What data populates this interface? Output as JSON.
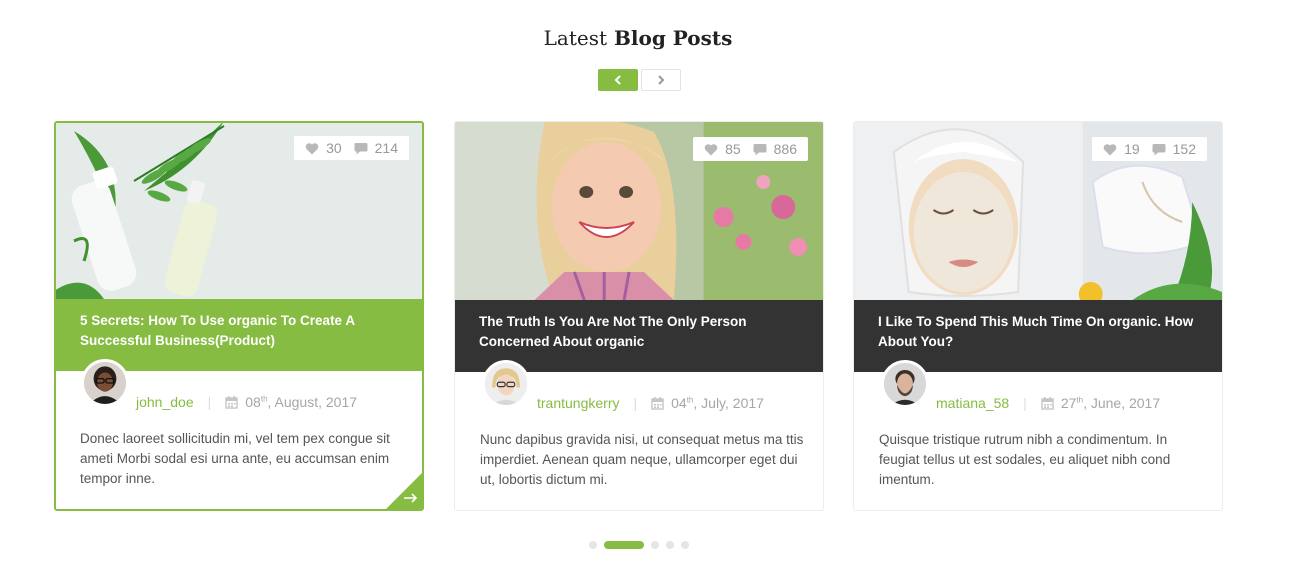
{
  "section": {
    "title_light": "Latest",
    "title_bold": "Blog Posts"
  },
  "nav": {
    "prev_icon": "chevron-left-icon",
    "next_icon": "chevron-right-icon"
  },
  "colors": {
    "accent": "#86bc42",
    "dark": "#333333"
  },
  "posts": [
    {
      "likes": "30",
      "comments": "214",
      "title": "5 Secrets: How To Use organic To Create A Successful Business(Product)",
      "author": "john_doe",
      "date_day": "08",
      "date_suffix": "th",
      "date_rest": ", August, 2017",
      "excerpt": "Donec laoreet sollicitudin mi, vel tem pex congue sit ameti Morbi sodal esi urna ante, eu accumsan enim tempor inne."
    },
    {
      "likes": "85",
      "comments": "886",
      "title": "The Truth Is You Are Not The Only Person Concerned About organic",
      "author": "trantungkerry",
      "date_day": "04",
      "date_suffix": "th",
      "date_rest": ", July, 2017",
      "excerpt": "Nunc dapibus gravida nisi, ut consequat metus ma ttis imperdiet. Aenean quam neque, ullamcorper eget dui ut, lobortis dictum mi."
    },
    {
      "likes": "19",
      "comments": "152",
      "title": "I Like To Spend This Much Time On organic. How About You?",
      "author": "matiana_58",
      "date_day": "27",
      "date_suffix": "th",
      "date_rest": ", June, 2017",
      "excerpt": "Quisque tristique rutrum nibh a condimentum. In feugiat tellus ut est sodales, eu aliquet nibh cond imentum."
    }
  ],
  "pagination": {
    "active_index": 1,
    "count": 5
  }
}
